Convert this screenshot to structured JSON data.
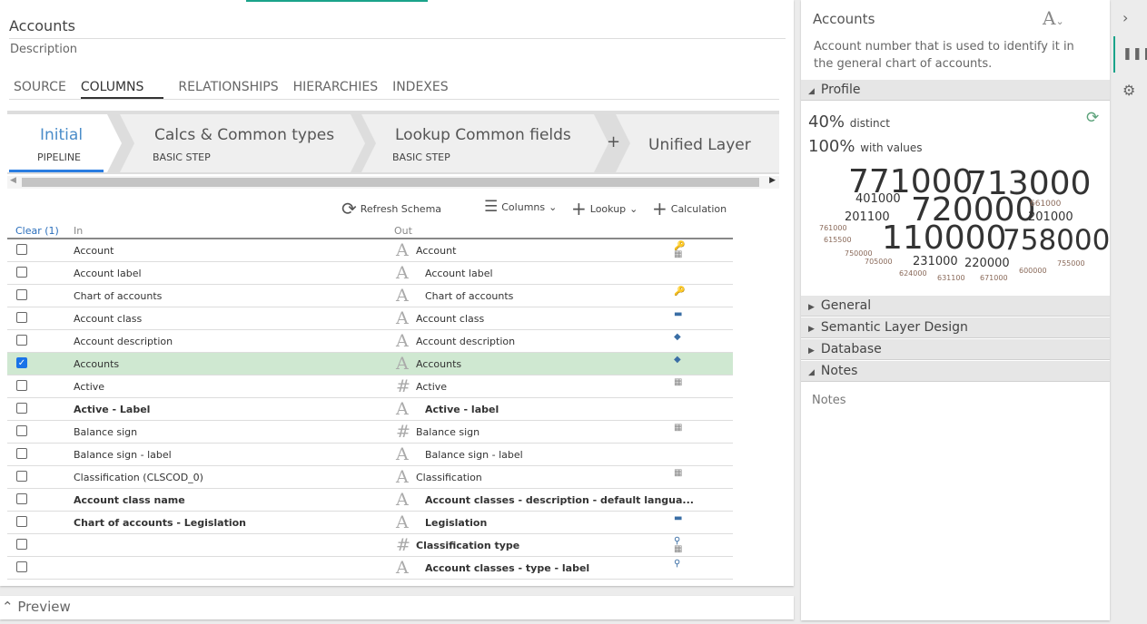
{
  "title": "Accounts",
  "description_label": "Description",
  "tabs": [
    "SOURCE",
    "COLUMNS",
    "RELATIONSHIPS",
    "HIERARCHIES",
    "INDEXES"
  ],
  "active_tab": "COLUMNS",
  "pipeline": [
    {
      "name": "Initial",
      "sub": "PIPELINE"
    },
    {
      "name": "Calcs & Common types",
      "sub": "BASIC STEP"
    },
    {
      "name": "Lookup Common fields",
      "sub": "BASIC STEP"
    },
    {
      "name": "Unified Layer",
      "sub": ""
    }
  ],
  "pipeline_add": "+",
  "toolbar": {
    "refresh": "Refresh Schema",
    "columns": "Columns",
    "lookup": "Lookup",
    "calculation": "Calculation"
  },
  "table": {
    "clear": "Clear (1)",
    "col_in": "In",
    "col_out": "Out",
    "rows": [
      {
        "checked": false,
        "in": "Account",
        "out": "Account",
        "type": "A",
        "bold": false,
        "indent": false,
        "icons": [
          "key-icon",
          "table-icon"
        ]
      },
      {
        "checked": false,
        "in": "Account label",
        "out": "Account label",
        "type": "A",
        "bold": false,
        "indent": true,
        "icons": []
      },
      {
        "checked": false,
        "in": "Chart of accounts",
        "out": "Chart of accounts",
        "type": "A",
        "bold": false,
        "indent": true,
        "icons": [
          "foreign-key-icon"
        ]
      },
      {
        "checked": false,
        "in": "Account class",
        "out": "Account class",
        "type": "A",
        "bold": false,
        "indent": false,
        "icons": [
          "dimension-icon"
        ]
      },
      {
        "checked": false,
        "in": "Account description",
        "out": "Account description",
        "type": "A",
        "bold": false,
        "indent": false,
        "icons": [
          "tag-icon"
        ]
      },
      {
        "checked": true,
        "in": "Accounts",
        "out": "Accounts",
        "type": "A",
        "bold": false,
        "indent": false,
        "icons": [
          "tag-icon"
        ],
        "selected": true
      },
      {
        "checked": false,
        "in": "Active",
        "out": "Active",
        "type": "#",
        "bold": false,
        "indent": false,
        "icons": [
          "table-icon"
        ]
      },
      {
        "checked": false,
        "in": "Active - Label",
        "out": "Active - label",
        "type": "A",
        "bold": true,
        "indent": true,
        "icons": []
      },
      {
        "checked": false,
        "in": "Balance sign",
        "out": "Balance sign",
        "type": "#",
        "bold": false,
        "indent": false,
        "icons": [
          "table-icon"
        ]
      },
      {
        "checked": false,
        "in": "Balance sign - label",
        "out": "Balance sign - label",
        "type": "A",
        "bold": false,
        "indent": true,
        "icons": []
      },
      {
        "checked": false,
        "in": "Classification (CLSCOD_0)",
        "out": "Classification",
        "type": "A",
        "bold": false,
        "indent": false,
        "icons": [
          "table-icon"
        ]
      },
      {
        "checked": false,
        "in": "Account class name",
        "out": "Account classes - description - default langua...",
        "type": "A",
        "bold": true,
        "indent": true,
        "icons": []
      },
      {
        "checked": false,
        "in": "Chart of accounts - Legislation",
        "out": "Legislation",
        "type": "A",
        "bold": true,
        "indent": true,
        "icons": [
          "dimension-icon"
        ]
      },
      {
        "checked": false,
        "in": "",
        "out": "Classification type",
        "type": "#",
        "bold": true,
        "indent": false,
        "icons": [
          "search-icon",
          "table-icon"
        ]
      },
      {
        "checked": false,
        "in": "",
        "out": "Account classes - type - label",
        "type": "A",
        "bold": true,
        "indent": true,
        "icons": [
          "search-icon"
        ]
      }
    ]
  },
  "preview_label": "Preview",
  "panel": {
    "title": "Accounts",
    "description": "Account number that is used to identify it in the general chart of accounts.",
    "profile_label": "Profile",
    "distinct_value": "40%",
    "distinct_label": "distinct",
    "values_value": "100%",
    "values_label": "with values",
    "cloud": [
      "771000",
      "713000",
      "401000",
      "720000",
      "661000",
      "201100",
      "201000",
      "761000",
      "615500",
      "110000",
      "758000",
      "750000",
      "705000",
      "231000",
      "220000",
      "755000",
      "624000",
      "631100",
      "671000",
      "600000"
    ],
    "sections": [
      "General",
      "Semantic Layer Design",
      "Database",
      "Notes"
    ],
    "notes_placeholder": "Notes"
  },
  "colors": {
    "accent": "#1aa38a",
    "active_step": "#4a8cc9",
    "selected_row": "#cfe8d1"
  }
}
